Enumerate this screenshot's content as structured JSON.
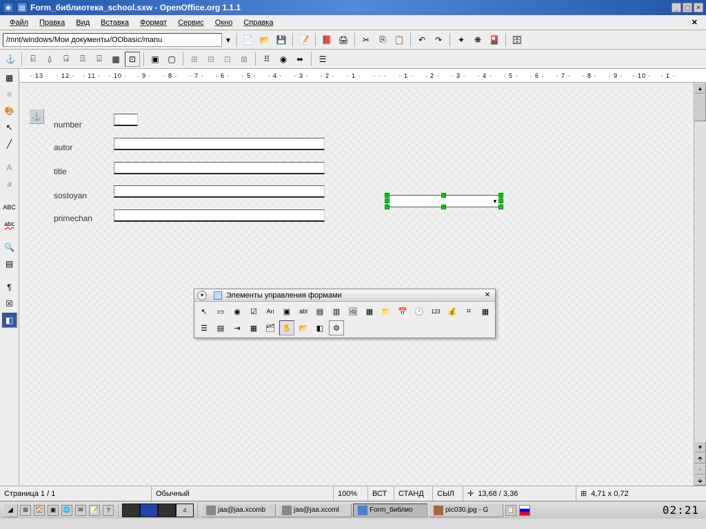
{
  "titlebar": {
    "text": "Form_библиотека_school.sxw - OpenOffice.org 1.1.1"
  },
  "menu": {
    "file": "Файл",
    "edit": "Правка",
    "view": "Вид",
    "insert": "Вставка",
    "format": "Формат",
    "service": "Сервис",
    "window": "Окно",
    "help": "Справка"
  },
  "toolbar": {
    "path": "/mnt/windows/Мои документы/OObasic/manu"
  },
  "form": {
    "labels": {
      "number": "number",
      "autor": "autor",
      "title": "title",
      "sostoyan": "sostoyan",
      "primechan": "primechan"
    }
  },
  "float": {
    "title": "Элементы управления формами"
  },
  "status": {
    "page": "Страница  1 / 1",
    "style": "Обычный",
    "zoom": "100%",
    "ins": "ВСТ",
    "std": "СТАНД",
    "sel": "СЫЛ",
    "pos": "13,68 / 3,36",
    "size": "4,71 x 0,72"
  },
  "taskbar": {
    "pager4": "4",
    "task1": "jaa@jaa.xcomb",
    "task2": "jaa@jaa.xcoml",
    "task3": "Form_библио",
    "task4": "pic030.jpg - G",
    "clock": "02:21"
  },
  "ruler": {
    "marks": [
      "13",
      "12",
      "11",
      "10",
      "9",
      "8",
      "7",
      "6",
      "5",
      "4",
      "3",
      "2",
      "1",
      "",
      "1",
      "2",
      "3",
      "4",
      "5",
      "6",
      "7",
      "8",
      "9",
      "10",
      "1"
    ]
  }
}
